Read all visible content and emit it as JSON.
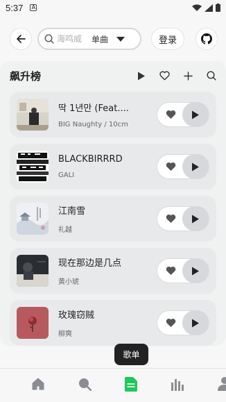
{
  "status": {
    "time": "5:37",
    "notification": "A"
  },
  "header": {
    "search_placeholder": "海鸣威",
    "search_mode": "单曲",
    "login_label": "登录"
  },
  "chart": {
    "title": "飙升榜"
  },
  "songs": [
    {
      "title": "딱 1년만 (Feat....",
      "artist": "BIG Naughty / 10cm",
      "cover": "cover-room"
    },
    {
      "title": "BLACKBIRRRD",
      "artist": "GALI",
      "cover": "cover-typography"
    },
    {
      "title": "江南雪",
      "artist": "礼越",
      "cover": "cover-snow"
    },
    {
      "title": "现在那边是几点",
      "artist": "黄小琥",
      "cover": "cover-night"
    },
    {
      "title": "玫瑰窃贼",
      "artist": "柳爽",
      "cover": "cover-rose"
    }
  ],
  "tooltip": "歌单",
  "nav": {
    "active": "playlists",
    "items": [
      "home-icon",
      "search-icon",
      "playlist-icon",
      "charts-icon",
      "profile-icon"
    ]
  },
  "colors": {
    "accent": "#22c55e",
    "pill_play": "#d7d8dc",
    "panel": "#f0f1f1"
  }
}
